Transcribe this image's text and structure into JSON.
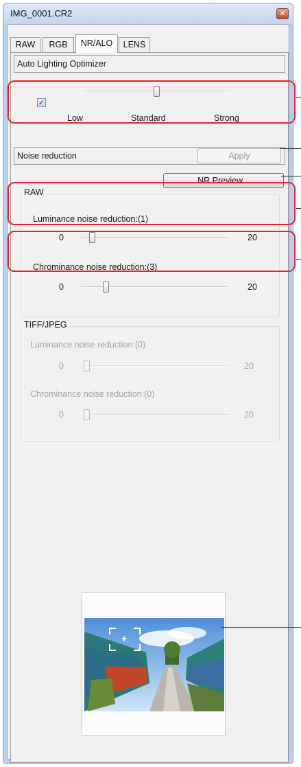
{
  "window": {
    "title": "IMG_0001.CR2",
    "close_glyph": "✕"
  },
  "tabs": [
    {
      "label": "RAW",
      "active": false
    },
    {
      "label": "RGB",
      "active": false
    },
    {
      "label": "NR/ALO",
      "active": true
    },
    {
      "label": "LENS",
      "active": false
    }
  ],
  "alo": {
    "header": "Auto Lighting Optimizer",
    "checked": true,
    "check_glyph": "✓",
    "level": "Standard",
    "scale_labels": [
      "Low",
      "Standard",
      "Strong"
    ]
  },
  "noise_reduction": {
    "header": "Noise reduction",
    "apply_label": "Apply",
    "apply_enabled": false,
    "preview_label": "NR Preview..."
  },
  "raw_group": {
    "title": "RAW",
    "luminance": {
      "label": "Luminance noise reduction:(1)",
      "value": 1,
      "min": "0",
      "max": "20"
    },
    "chrominance": {
      "label": "Chrominance noise reduction:(3)",
      "value": 3,
      "min": "0",
      "max": "20"
    }
  },
  "tiff_group": {
    "title": "TIFF/JPEG",
    "enabled": false,
    "luminance": {
      "label": "Luminance noise reduction:(0)",
      "value": 0,
      "min": "0",
      "max": "20"
    },
    "chrominance": {
      "label": "Chrominance noise reduction:(0)",
      "value": 0,
      "min": "0",
      "max": "20"
    }
  },
  "navigator": {
    "preview_icon": "train-photo-thumbnail",
    "crosshair_glyph": "+"
  },
  "colors": {
    "highlight": "#e0262e",
    "title_bar": "#c3d6ec",
    "panel": "#f0f0f0"
  }
}
